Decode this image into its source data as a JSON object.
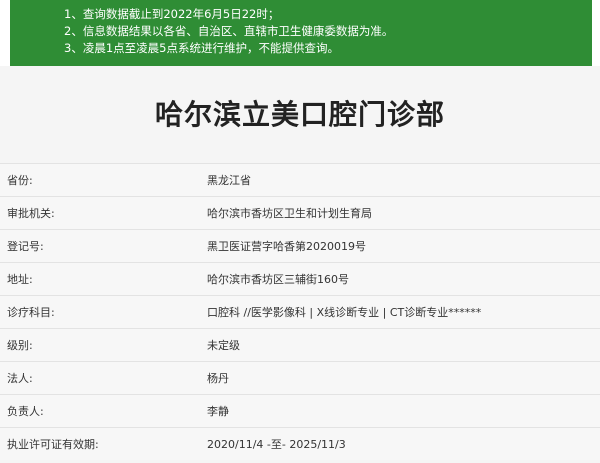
{
  "notice": {
    "lines": [
      "1、查询数据截止到2022年6月5日22时；",
      "2、信息数据结果以各省、自治区、直辖市卫生健康委数据为准。",
      "3、凌晨1点至凌晨5点系统进行维护，不能提供查询。"
    ]
  },
  "title": "哈尔滨立美口腔门诊部",
  "rows": [
    {
      "label": "省份:",
      "value": "黑龙江省"
    },
    {
      "label": "审批机关:",
      "value": "哈尔滨市香坊区卫生和计划生育局"
    },
    {
      "label": "登记号:",
      "value": "黑卫医证营字哈香第2020019号"
    },
    {
      "label": "地址:",
      "value": "哈尔滨市香坊区三辅街160号"
    },
    {
      "label": "诊疗科目:",
      "value": "口腔科 //医学影像科 | X线诊断专业 | CT诊断专业******"
    },
    {
      "label": "级别:",
      "value": "未定级"
    },
    {
      "label": "法人:",
      "value": "杨丹"
    },
    {
      "label": "负责人:",
      "value": "李静"
    },
    {
      "label": "执业许可证有效期:",
      "value": "2020/11/4 -至- 2025/11/3"
    }
  ]
}
